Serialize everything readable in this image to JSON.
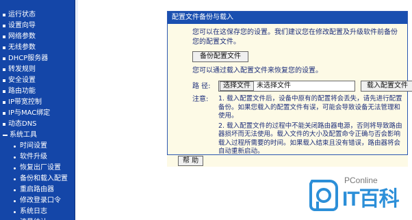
{
  "sidebar": {
    "items": [
      {
        "label": "运行状态",
        "level": 0
      },
      {
        "label": "设置向导",
        "level": 0
      },
      {
        "label": "网络参数",
        "level": 0
      },
      {
        "label": "无线参数",
        "level": 0
      },
      {
        "label": "DHCP服务器",
        "level": 0
      },
      {
        "label": "转发规则",
        "level": 0
      },
      {
        "label": "安全设置",
        "level": 0
      },
      {
        "label": "路由功能",
        "level": 0
      },
      {
        "label": "IP带宽控制",
        "level": 0
      },
      {
        "label": "IP与MAC绑定",
        "level": 0
      },
      {
        "label": "动态DNS",
        "level": 0
      },
      {
        "label": "系统工具",
        "level": 0,
        "expanded": true
      },
      {
        "label": "时间设置",
        "level": 1
      },
      {
        "label": "软件升级",
        "level": 1
      },
      {
        "label": "恢复出厂设置",
        "level": 1
      },
      {
        "label": "备份和载入配置",
        "level": 1
      },
      {
        "label": "重启路由器",
        "level": 1
      },
      {
        "label": "修改登录口令",
        "level": 1
      },
      {
        "label": "系统日志",
        "level": 1
      },
      {
        "label": "流量统计",
        "level": 1
      }
    ]
  },
  "panel": {
    "title": "配置文件备份与载入",
    "intro": "您可以在这保存您的设置。我们建议您在修改配置及升级软件前备份您的配置文件。",
    "backup_button": "备份配置文件",
    "restore_text": "您可以通过载入配置文件来恢复您的设置。",
    "path_label": "路 径:",
    "choose_file": "选择文件",
    "no_file": "未选择文件",
    "load_button": "载入配置文件",
    "notes_label": "注意:",
    "note1": "1. 载入配置文件后，设备中原有的配置将会丢失，请先进行配置备份。如果您载入的配置文件有误，可能会导致设备无法管理和使用。",
    "note2": "2. 载入配置文件的过程中不能关闭路由器电源，否则将导致路由器损坏而无法使用。载入文件的大小及配置命令正确与否会影响载入过程所需要的时间。如果载入结束且没有错误，路由器将会自动重新启动。",
    "help_button": "帮 助"
  },
  "watermark": {
    "brand": "PConline",
    "big": "IT百科"
  },
  "colors": {
    "sidebar_bg": "#1446a8",
    "title_bg": "#1a4fb0",
    "panel_bg": "#fdfae6",
    "watermark_accent": "#2c8fd8"
  }
}
